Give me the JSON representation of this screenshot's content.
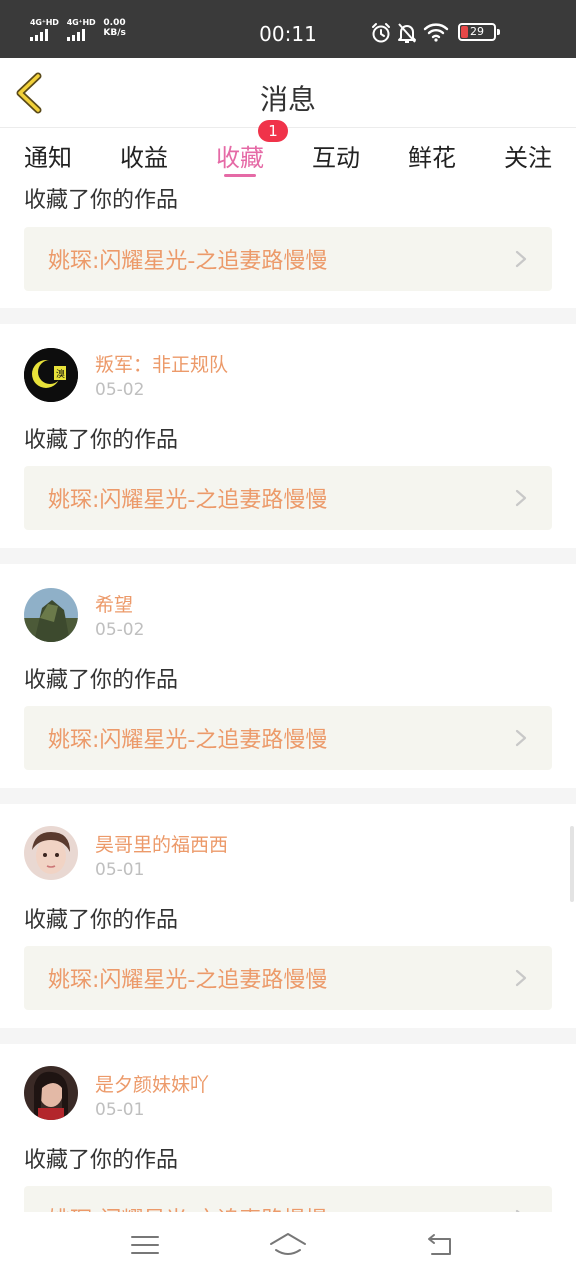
{
  "status_bar": {
    "sim1_label": "4G⁺HD",
    "sim2_label": "4G⁺HD",
    "net_speed_value": "0.00",
    "net_speed_unit": "KB/s",
    "time": "00:11",
    "battery": "29",
    "icons": [
      "alarm-icon",
      "mute-icon",
      "wifi-icon",
      "battery-icon"
    ]
  },
  "header": {
    "title": "消息",
    "back_icon": "chevron-left-icon"
  },
  "tabs": {
    "items": [
      {
        "label": "通知"
      },
      {
        "label": "收益"
      },
      {
        "label": "收藏",
        "active": true,
        "badge": "1"
      },
      {
        "label": "互动"
      },
      {
        "label": "鲜花"
      },
      {
        "label": "关注"
      }
    ]
  },
  "feed": {
    "partial_top": {
      "action": "收藏了你的作品",
      "work_title": "姚琛:闪耀星光-之追妻路慢慢"
    },
    "items": [
      {
        "user": "叛军：非正规队",
        "date": "05-02",
        "action": "收藏了你的作品",
        "work_title": "姚琛:闪耀星光-之追妻路慢慢"
      },
      {
        "user": "希望",
        "date": "05-02",
        "action": "收藏了你的作品",
        "work_title": "姚琛:闪耀星光-之追妻路慢慢"
      },
      {
        "user": "昊哥里的福西西",
        "date": "05-01",
        "action": "收藏了你的作品",
        "work_title": "姚琛:闪耀星光-之追妻路慢慢"
      },
      {
        "user": "是夕颜妹妹吖",
        "date": "05-01",
        "action": "收藏了你的作品",
        "work_title": "姚琛:闪耀星光-之追妻路慢慢"
      }
    ]
  },
  "colors": {
    "accent_pink": "#e56aa6",
    "badge_red": "#f0334a",
    "username_orange": "#ec9a6a",
    "work_bg": "#f5f5ef"
  },
  "navbar": {
    "icons": [
      "menu-icon",
      "home-icon",
      "back-icon"
    ]
  }
}
